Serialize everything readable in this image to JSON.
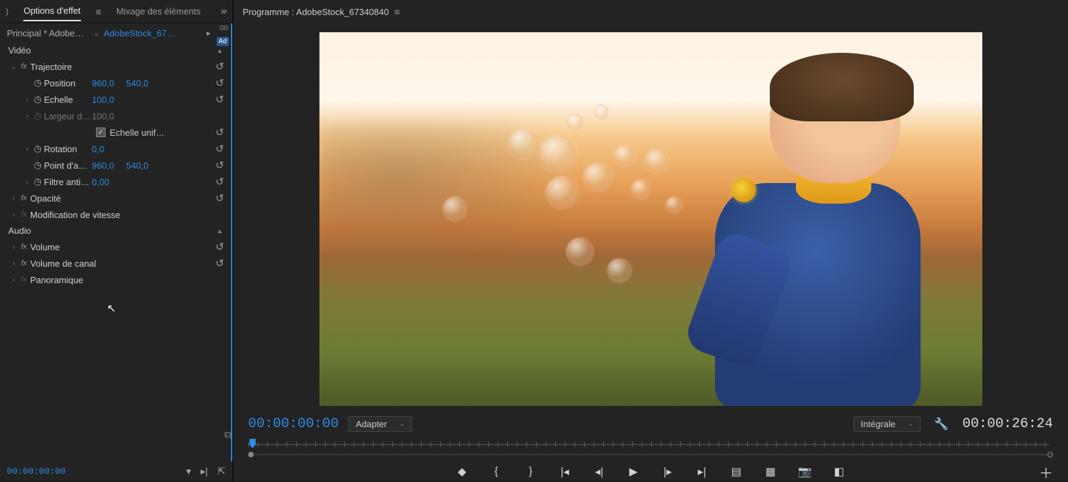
{
  "tabs": {
    "effects": "Options d'effet",
    "mixing": "Mixage des éléments"
  },
  "crumb": {
    "master": "Principal * AdobeSt…",
    "clip": "AdobeStock_67…",
    "tc_head": ":00:",
    "badge": "Ad"
  },
  "sections": {
    "video": "Vidéo",
    "audio": "Audio"
  },
  "fx": {
    "motion": "Trajectoire",
    "position": "Position",
    "pos_x": "960,0",
    "pos_y": "540,0",
    "scale": "Echelle",
    "scale_v": "100,0",
    "scale_w": "Largeur d'é…",
    "scale_w_v": "100,0",
    "uniform": "Echelle unif…",
    "rotation": "Rotation",
    "rot_v": "0,0",
    "anchor": "Point d'ancr…",
    "anc_x": "960,0",
    "anc_y": "540,0",
    "flicker": "Filtre antisc…",
    "flk_v": "0,00",
    "opacity": "Opacité",
    "speed": "Modification de vitesse",
    "volume": "Volume",
    "chvol": "Volume de canal",
    "pan": "Panoramique"
  },
  "left_tc": "00:00:00:00",
  "program": {
    "title": "Programme : AdobeStock_67340840"
  },
  "time": {
    "current": "00:00:00:00",
    "zoom": "Adapter",
    "res": "Intégrale",
    "duration": "00:00:26:24"
  }
}
